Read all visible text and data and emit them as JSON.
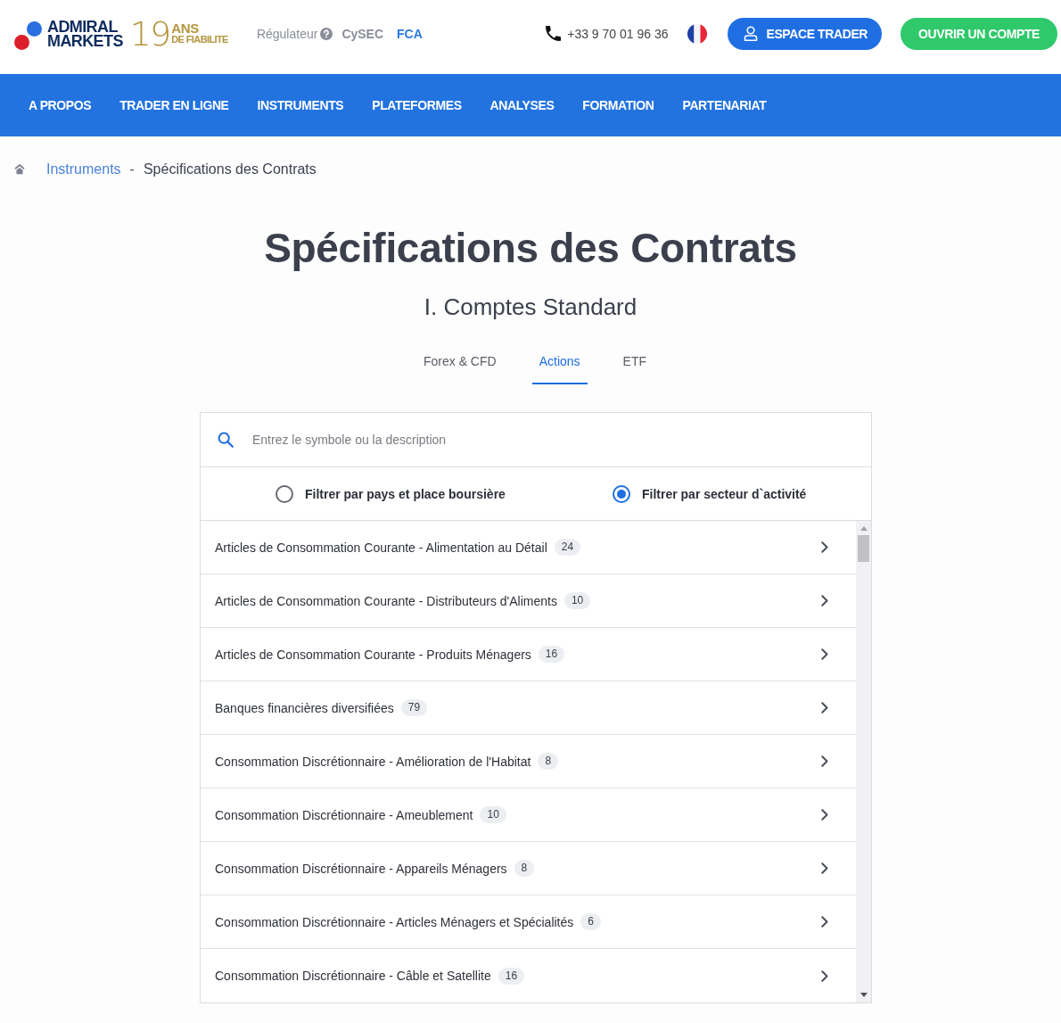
{
  "header": {
    "logo": {
      "brand": [
        "ADMIRAL",
        "MARKETS"
      ],
      "years": "19",
      "tagline": [
        "ANS",
        "DE FIABILITE"
      ]
    },
    "regulator": {
      "label": "Régulateur",
      "items": [
        {
          "label": "CySEC",
          "selected": false
        },
        {
          "label": "FCA",
          "selected": true
        }
      ]
    },
    "phone": "+33 9 70 01 96 36",
    "buttons": [
      {
        "label": "ESPACE TRADER",
        "kind": "primary"
      },
      {
        "label": "OUVRIR UN COMPTE",
        "kind": "success"
      }
    ]
  },
  "nav": {
    "items": [
      "A PROPOS",
      "TRADER EN LIGNE",
      "INSTRUMENTS",
      "PLATEFORMES",
      "ANALYSES",
      "FORMATION",
      "PARTENARIAT"
    ]
  },
  "breadcrumb": [
    {
      "label": "Instruments",
      "kind": "link"
    },
    {
      "label": "-",
      "kind": "separator"
    },
    {
      "label": "Spécifications des Contrats",
      "kind": "current"
    }
  ],
  "page": {
    "title": "Spécifications des Contrats",
    "subtitle": "I. Comptes Standard"
  },
  "tabs": [
    {
      "label": "Forex & CFD",
      "selected": false
    },
    {
      "label": "Actions",
      "selected": true
    },
    {
      "label": "ETF",
      "selected": false
    }
  ],
  "search": {
    "placeholder": "Entrez le symbole ou la description"
  },
  "filters": [
    {
      "label": "Filtrer par pays et place boursière",
      "selected": false
    },
    {
      "label": "Filtrer par secteur d`activité",
      "selected": true
    }
  ],
  "sectors": [
    {
      "name": "Articles de Consommation Courante - Alimentation au Détail",
      "count": "24"
    },
    {
      "name": "Articles de Consommation Courante - Distributeurs d'Aliments",
      "count": "10"
    },
    {
      "name": "Articles de Consommation Courante - Produits Ménagers",
      "count": "16"
    },
    {
      "name": "Banques financières diversifiées",
      "count": "79"
    },
    {
      "name": "Consommation Discrétionnaire - Amélioration de l'Habitat",
      "count": "8"
    },
    {
      "name": "Consommation Discrétionnaire - Ameublement",
      "count": "10"
    },
    {
      "name": "Consommation Discrétionnaire - Appareils Ménagers",
      "count": "8"
    },
    {
      "name": "Consommation Discrétionnaire - Articles Ménagers et Spécialités",
      "count": "6"
    },
    {
      "name": "Consommation Discrétionnaire - Câble et Satellite",
      "count": "16"
    }
  ]
}
